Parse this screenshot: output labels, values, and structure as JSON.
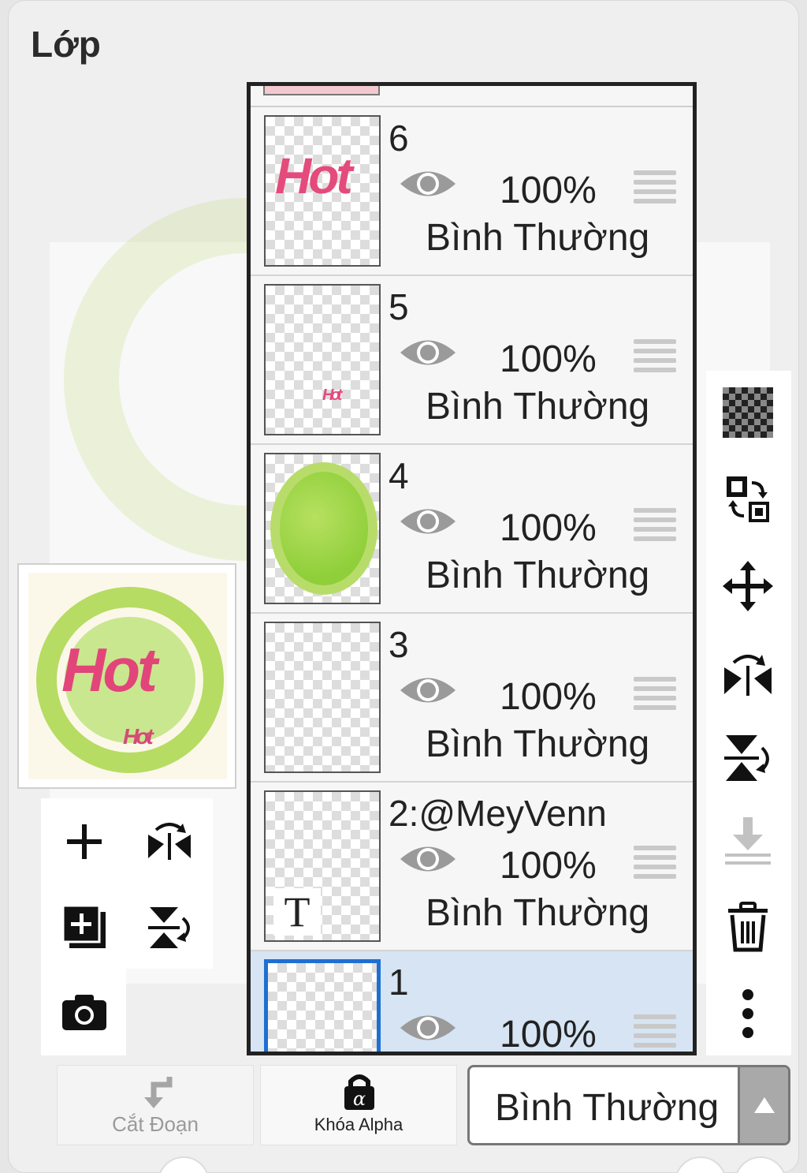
{
  "panel": {
    "title": "Lớp"
  },
  "layers": [
    {
      "name": "6",
      "opacity": "100%",
      "blend": "Bình Thường",
      "selected": false,
      "thumb_text": "Hot"
    },
    {
      "name": "5",
      "opacity": "100%",
      "blend": "Bình Thường",
      "selected": false,
      "thumb_text": "Hot"
    },
    {
      "name": "4",
      "opacity": "100%",
      "blend": "Bình Thường",
      "selected": false
    },
    {
      "name": "3",
      "opacity": "100%",
      "blend": "Bình Thường",
      "selected": false
    },
    {
      "name": "2:@MeyVenn",
      "opacity": "100%",
      "blend": "Bình Thường",
      "selected": false,
      "thumb_text": "T"
    },
    {
      "name": "1",
      "opacity": "100%",
      "blend": "",
      "selected": true
    }
  ],
  "preview": {
    "text_main": "Hot",
    "text_sub": "Hot"
  },
  "right_tools": [
    "checker-icon",
    "swap-layer-icon",
    "move-icon",
    "flip-horizontal-icon",
    "flip-vertical-icon",
    "merge-down-icon",
    "trash-icon",
    "more-icon"
  ],
  "left_tools": [
    "add-layer-icon",
    "flip-horizontal-small-icon",
    "add-copy-layer-icon",
    "flip-vertical-small-icon",
    "camera-icon"
  ],
  "bottom": {
    "clipping_label": "Cắt Đoạn",
    "alpha_lock_label": "Khóa Alpha",
    "blend_mode_value": "Bình Thường"
  },
  "colors": {
    "selected_row": "#d6e4f3",
    "selected_border": "#1f6fd1",
    "accent_pink": "#e44b7c",
    "accent_green": "#b8dc6a"
  }
}
